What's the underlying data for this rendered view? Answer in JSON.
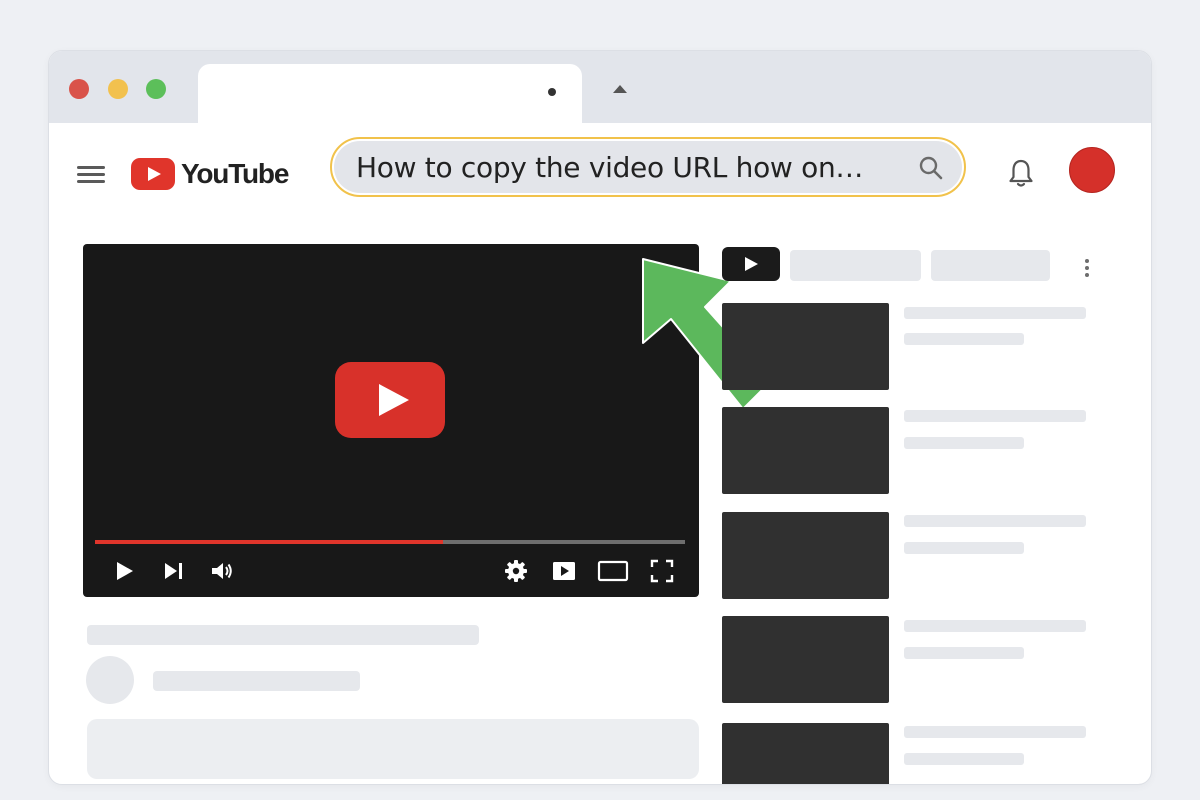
{
  "window": {
    "active_tab_title": ""
  },
  "header": {
    "logo_text": "YouTube",
    "search": {
      "value": "How to copy the video URL how on…",
      "placeholder": ""
    }
  },
  "player": {
    "progress": 0.59
  },
  "sidebar": {
    "recommendation_count": 5
  },
  "colors": {
    "brand_red": "#e0352b",
    "highlight_border": "#f1c24b",
    "arrow_green": "#5cb85c"
  },
  "icons": [
    "menu-icon",
    "youtube-logo-icon",
    "search-icon",
    "bell-icon",
    "play-icon",
    "next-icon",
    "volume-icon",
    "settings-icon",
    "miniplayer-icon",
    "theater-icon",
    "fullscreen-icon"
  ]
}
